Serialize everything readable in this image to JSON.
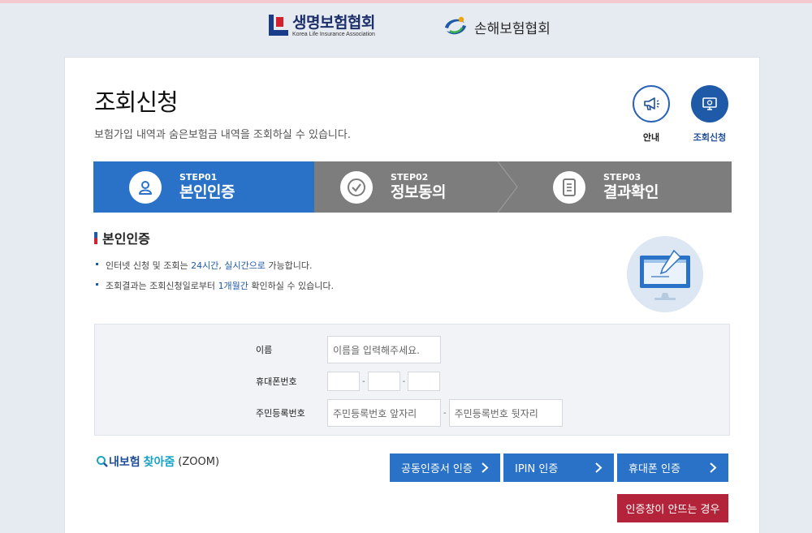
{
  "header": {
    "klia_name": "생명보험협회",
    "klia_sub": "Korea Life Insurance Association",
    "gia_name": "손해보험협회"
  },
  "page": {
    "title": "조회신청",
    "description": "보험가입 내역과 숨은보험금 내역을 조회하실 수 있습니다."
  },
  "quick_buttons": {
    "guide_label": "안내",
    "inquiry_label": "조회신청",
    "guide_icon": "megaphone-icon",
    "inquiry_icon": "monitor-icon"
  },
  "steps": [
    {
      "num": "STEP01",
      "name": "본인인증",
      "icon": "person-icon",
      "active": true
    },
    {
      "num": "STEP02",
      "name": "정보동의",
      "icon": "check-icon",
      "active": false
    },
    {
      "num": "STEP03",
      "name": "결과확인",
      "icon": "document-icon",
      "active": false
    }
  ],
  "section": {
    "title": "본인인증",
    "bullet1_pre": "인터넷 신청 및 조회는 ",
    "bullet1_hl1": "24시간",
    "bullet1_mid": ", ",
    "bullet1_hl2": "실시간으로",
    "bullet1_post": " 가능합니다.",
    "bullet2_pre": "조회결과는 조회신청일로부터 ",
    "bullet2_hl": "1개월간",
    "bullet2_post": " 확인하실 수 있습니다."
  },
  "form": {
    "name_label": "이름",
    "name_placeholder": "이름을 입력해주세요.",
    "phone_label": "휴대폰번호",
    "phone_dash": "-",
    "rrn_label": "주민등록번호",
    "rrn_front_placeholder": "주민등록번호 앞자리",
    "rrn_back_placeholder": "주민등록번호 뒷자리",
    "rrn_dash": "-"
  },
  "zoom": {
    "part1": "내보험",
    "part2": "찾아줌",
    "part3": "(ZOOM)"
  },
  "auth_buttons": {
    "cert": "공동인증서 인증",
    "ipin": "IPIN 인증",
    "phone": "휴대폰 인증",
    "popup_fail": "인증창이 안뜨는 경우"
  },
  "colors": {
    "primary": "#2a72c8",
    "step_inactive": "#7d7d7d",
    "warning": "#b3243a",
    "brand_navy": "#1c2f6b",
    "brand_red": "#d3212f"
  }
}
